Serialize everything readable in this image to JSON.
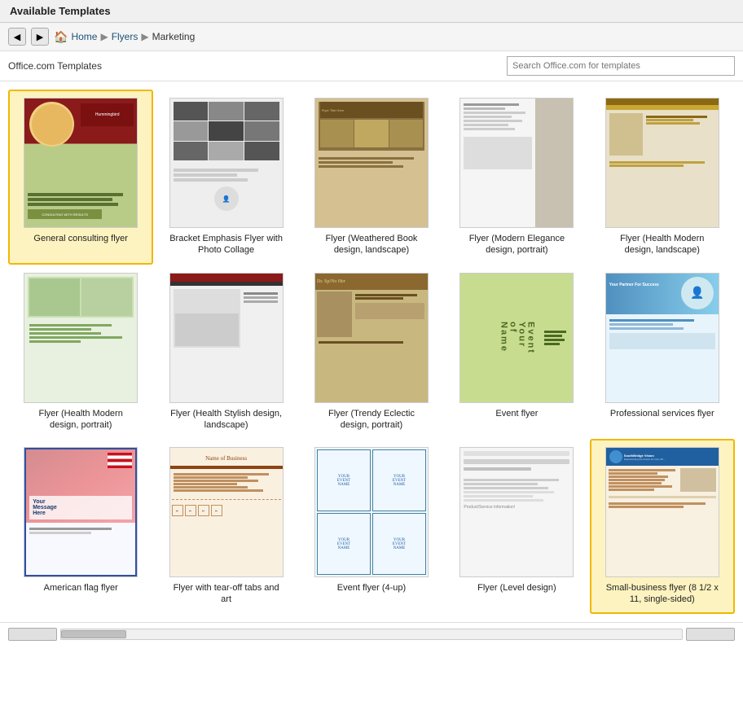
{
  "header": {
    "title": "Available Templates"
  },
  "nav": {
    "back_btn": "◀",
    "forward_btn": "▶",
    "home_label": "Home",
    "breadcrumb": [
      {
        "label": "Home",
        "sep": "▶"
      },
      {
        "label": "Flyers",
        "sep": "▶"
      },
      {
        "label": "Marketing",
        "sep": ""
      }
    ]
  },
  "toolbar": {
    "label": "Office.com Templates",
    "search_placeholder": "Search Office.com for templates"
  },
  "templates": [
    {
      "id": "t1",
      "label": "General consulting flyer",
      "selected": true,
      "thumb_class": "t1"
    },
    {
      "id": "t2",
      "label": "Bracket Emphasis Flyer with Photo Collage",
      "selected": false,
      "thumb_class": "t2"
    },
    {
      "id": "t3",
      "label": "Flyer (Weathered Book design, landscape)",
      "selected": false,
      "thumb_class": "t3"
    },
    {
      "id": "t4",
      "label": "Flyer (Modern Elegance design, portrait)",
      "selected": false,
      "thumb_class": "t4"
    },
    {
      "id": "t5",
      "label": "Flyer (Health Modern design, landscape)",
      "selected": false,
      "thumb_class": "t5"
    },
    {
      "id": "t6",
      "label": "Flyer (Health Modern design, portrait)",
      "selected": false,
      "thumb_class": "t6"
    },
    {
      "id": "t7",
      "label": "Flyer (Health Stylish design, landscape)",
      "selected": false,
      "thumb_class": "t7"
    },
    {
      "id": "t8",
      "label": "Flyer (Trendy Eclectic design, portrait)",
      "selected": false,
      "thumb_class": "t8"
    },
    {
      "id": "t9",
      "label": "Event flyer",
      "selected": false,
      "thumb_class": "t9",
      "is_tour": true
    },
    {
      "id": "t10",
      "label": "Professional services flyer",
      "selected": false,
      "thumb_class": "t10"
    },
    {
      "id": "t11",
      "label": "American flag flyer",
      "selected": false,
      "thumb_class": "t11"
    },
    {
      "id": "t12",
      "label": "Flyer with tear-off tabs and art",
      "selected": false,
      "thumb_class": "t12"
    },
    {
      "id": "t13",
      "label": "Event flyer (4-up)",
      "selected": false,
      "thumb_class": "t13"
    },
    {
      "id": "t14",
      "label": "Flyer (Level design)",
      "selected": false,
      "thumb_class": "t14"
    },
    {
      "id": "t15",
      "label": "Small-business flyer (8 1/2 x 11, single-sided)",
      "selected": true,
      "thumb_class": "t15"
    }
  ],
  "scrollbar": {
    "left_btn": "◀",
    "right_btn": "▶"
  }
}
